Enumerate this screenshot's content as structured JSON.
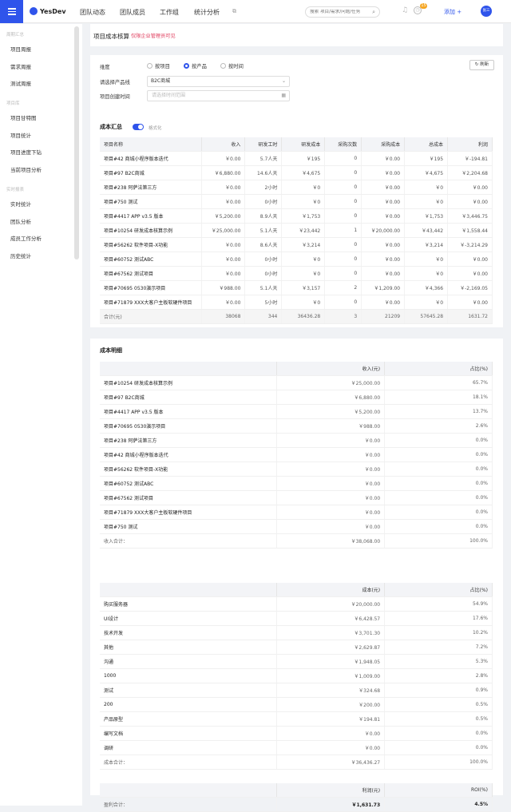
{
  "topbar": {
    "logo": "YesDev",
    "nav": [
      "团队动态",
      "团队成员",
      "工作组",
      "统计分析"
    ],
    "search_placeholder": "搜索 项目/需求/问题/任务",
    "notification_count": "15",
    "add_label": "添加 +",
    "avatar_text": "张三"
  },
  "sidebar": {
    "sections": [
      {
        "title": "周期汇总",
        "items": [
          "项目周报",
          "需求周报",
          "测试周报"
        ]
      },
      {
        "title": "项目库",
        "items": [
          "项目甘特图",
          "项目统计",
          "项目进度下钻",
          "当前项目分析"
        ]
      },
      {
        "title": "实时报表",
        "items": [
          "实时统计",
          "团队分析",
          "成员工作分析",
          "历史统计"
        ]
      }
    ]
  },
  "header": {
    "title": "项目成本核算",
    "note": "仅限企业管理员可见"
  },
  "filters": {
    "dimension_label": "维度",
    "dimension_options": [
      "按项目",
      "按产品",
      "按时间"
    ],
    "dimension_selected": 1,
    "refresh_label": "刷新",
    "product_line_label": "请选择产品线",
    "product_line_value": "B2C商城",
    "date_label": "项目创建时间",
    "date_placeholder": "请选择时间范围"
  },
  "summary": {
    "title": "成本汇总",
    "toggle_label": "格式化",
    "columns": [
      "项目名称",
      "收入",
      "研发工时",
      "研发成本",
      "采购次数",
      "采购成本",
      "总成本",
      "利润"
    ],
    "rows": [
      [
        "项目#42 商城小程序版本迭代",
        "￥0.00",
        "5.7人天",
        "￥195",
        "0",
        "￥0.00",
        "￥195",
        "￥-194.81"
      ],
      [
        "项目#97 B2C商城",
        "￥6,880.00",
        "14.6人天",
        "￥4,675",
        "0",
        "￥0.00",
        "￥4,675",
        "￥2,204.68"
      ],
      [
        "项目#238 阿萨法第三方",
        "￥0.00",
        "2小时",
        "￥0",
        "0",
        "￥0.00",
        "￥0",
        "￥0.00"
      ],
      [
        "项目#750 测试",
        "￥0.00",
        "0小时",
        "￥0",
        "0",
        "￥0.00",
        "￥0",
        "￥0.00"
      ],
      [
        "项目#4417 APP v3.5 版本",
        "￥5,200.00",
        "8.9人天",
        "￥1,753",
        "0",
        "￥0.00",
        "￥1,753",
        "￥3,446.75"
      ],
      [
        "项目#10254 研发成本核算示例",
        "￥25,000.00",
        "5.1人天",
        "￥23,442",
        "1",
        "￥20,000.00",
        "￥43,442",
        "￥1,558.44"
      ],
      [
        "项目#56262 软件项目-X功能",
        "￥0.00",
        "8.6人天",
        "￥3,214",
        "0",
        "￥0.00",
        "￥3,214",
        "￥-3,214.29"
      ],
      [
        "项目#60752 测试ABC",
        "￥0.00",
        "0小时",
        "￥0",
        "0",
        "￥0.00",
        "￥0",
        "￥0.00"
      ],
      [
        "项目#67562 测试项目",
        "￥0.00",
        "0小时",
        "￥0",
        "0",
        "￥0.00",
        "￥0",
        "￥0.00"
      ],
      [
        "项目#70695 0530演示项目",
        "￥988.00",
        "5.1人天",
        "￥3,157",
        "2",
        "￥1,209.00",
        "￥4,366",
        "￥-2,169.05"
      ],
      [
        "项目#71879 XXX大客户主板软硬件项目",
        "￥0.00",
        "5小时",
        "￥0",
        "0",
        "￥0.00",
        "￥0",
        "￥0.00"
      ]
    ],
    "total": [
      "合计(元)",
      "38068",
      "344",
      "36436.28",
      "3",
      "21209",
      "57645.28",
      "1631.72"
    ]
  },
  "detail": {
    "title": "成本明细",
    "income": {
      "columns": [
        "",
        "收入(元)",
        "占比(%)"
      ],
      "rows": [
        [
          "项目#10254 研发成本核算示例",
          "￥25,000.00",
          "65.7%"
        ],
        [
          "项目#97 B2C商城",
          "￥6,880.00",
          "18.1%"
        ],
        [
          "项目#4417 APP v3.5 版本",
          "￥5,200.00",
          "13.7%"
        ],
        [
          "项目#70695 0530演示项目",
          "￥988.00",
          "2.6%"
        ],
        [
          "项目#238 阿萨法第三方",
          "￥0.00",
          "0.0%"
        ],
        [
          "项目#42 商城小程序版本迭代",
          "￥0.00",
          "0.0%"
        ],
        [
          "项目#56262 软件项目-X功能",
          "￥0.00",
          "0.0%"
        ],
        [
          "项目#60752 测试ABC",
          "￥0.00",
          "0.0%"
        ],
        [
          "项目#67562 测试项目",
          "￥0.00",
          "0.0%"
        ],
        [
          "项目#71879 XXX大客户主板软硬件项目",
          "￥0.00",
          "0.0%"
        ],
        [
          "项目#750 测试",
          "￥0.00",
          "0.0%"
        ]
      ],
      "total": [
        "收入合计：",
        "￥38,068.00",
        "100.0%"
      ]
    },
    "cost": {
      "columns": [
        "",
        "成本(元)",
        "占比(%)"
      ],
      "rows": [
        [
          "购买服务器",
          "￥20,000.00",
          "54.9%"
        ],
        [
          "UI设计",
          "￥6,428.57",
          "17.6%"
        ],
        [
          "技术开发",
          "￥3,701.30",
          "10.2%"
        ],
        [
          "其他",
          "￥2,629.87",
          "7.2%"
        ],
        [
          "沟通",
          "￥1,948.05",
          "5.3%"
        ],
        [
          "1000",
          "￥1,009.00",
          "2.8%"
        ],
        [
          "测试",
          "￥324.68",
          "0.9%"
        ],
        [
          "200",
          "￥200.00",
          "0.5%"
        ],
        [
          "产品原型",
          "￥194.81",
          "0.5%"
        ],
        [
          "编写文档",
          "￥0.00",
          "0.0%"
        ],
        [
          "调研",
          "￥0.00",
          "0.0%"
        ]
      ],
      "total": [
        "成本合计：",
        "￥36,436.27",
        "100.0%"
      ]
    },
    "profit": {
      "columns": [
        "",
        "利润(元)",
        "ROI(%)"
      ],
      "total": [
        "盈利合计：",
        "￥1,631.73",
        "4.5%"
      ]
    }
  }
}
